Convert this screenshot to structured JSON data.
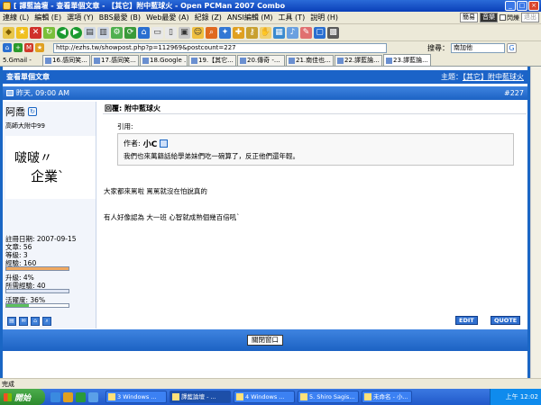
{
  "window": {
    "title": "[ 譯藍論壇 - 查看單個文章 - 【其它】附中藍球火 - Open PCMan 2007 Combo"
  },
  "menubar": {
    "items": [
      "連線 (L)",
      "編輯 (E)",
      "選項 (Y)",
      "BBS最愛 (B)",
      "Web最愛 (A)",
      "紀錄 (Z)",
      "ANSI編輯 (M)",
      "工具 (T)",
      "說明 (H)"
    ],
    "right": {
      "simplified": "簡易",
      "music": "音樂",
      "flash": "閃爍",
      "exit": "退出"
    }
  },
  "address": {
    "url": "http://ezhs.tw/showpost.php?p=112969&postcount=227",
    "search_label": "搜尋：",
    "search_value": "南加他"
  },
  "tabs": [
    {
      "label": "5.Gmail -"
    },
    {
      "label": "16.感同笑..."
    },
    {
      "label": "17.感同笑..."
    },
    {
      "label": "18.Google ..."
    },
    {
      "label": "19.【其它..."
    },
    {
      "label": "20.傳奇 -..."
    },
    {
      "label": "21.南佳也..."
    },
    {
      "label": "22.譯藍論..."
    },
    {
      "label": "23.譯藍論..."
    }
  ],
  "forum": {
    "page_heading": "查看單個文章",
    "topic_label": "主題：",
    "topic_text": "【其它】附中藍球火",
    "post_time": "昨天, 09:00 AM",
    "post_number": "#227",
    "post_title": "回覆: 附中藍球火",
    "quote_label": "引用:",
    "quote_author_label": "作者:",
    "quote_author": "小C",
    "quote_text": "我們也來萬籍話給學弟妹們吃一碗算了，反正他們還年輕。",
    "body_line1": "大家都來罵啦 罵罵就沒在怕說真的",
    "body_line2": "有人好像認為 大一班 心智就成熟個幾百倍吼`",
    "edit_label": "EDIT",
    "quote_button_label": "QUOTE",
    "close_window_label": "關閉窗口"
  },
  "user": {
    "name": "阿喬",
    "school": "高師大附中99",
    "avatar_line1": "啵啵〃",
    "avatar_line2": "企業`",
    "join_date": "註冊日期: 2007-09-15",
    "posts": "文章: 56",
    "level": "等級: 3",
    "exp": "經驗: 160",
    "exp_fill": 1.0,
    "upgrade": "升級: 4%",
    "upgrade_fill": 0.04,
    "needed": "所需經驗: 40",
    "needed_fill": 1.0,
    "activity": "活躍度: 36%",
    "activity_fill": 0.36
  },
  "statusbar": {
    "text": "完成"
  },
  "taskbar": {
    "start": "開始",
    "items": [
      {
        "label": "3 Windows ..."
      },
      {
        "label": "譯藍論壇 - ..."
      },
      {
        "label": "4 Windows ..."
      },
      {
        "label": "5. Shiro Sagis..."
      },
      {
        "label": "未命名 - 小..."
      }
    ],
    "clock": "上午 12:02"
  },
  "colors": {
    "forum_blue": "#1b63c8",
    "xp_blue": "#2159c9",
    "orange_bar": "#f0a860",
    "green_bar": "#5cc05c"
  }
}
